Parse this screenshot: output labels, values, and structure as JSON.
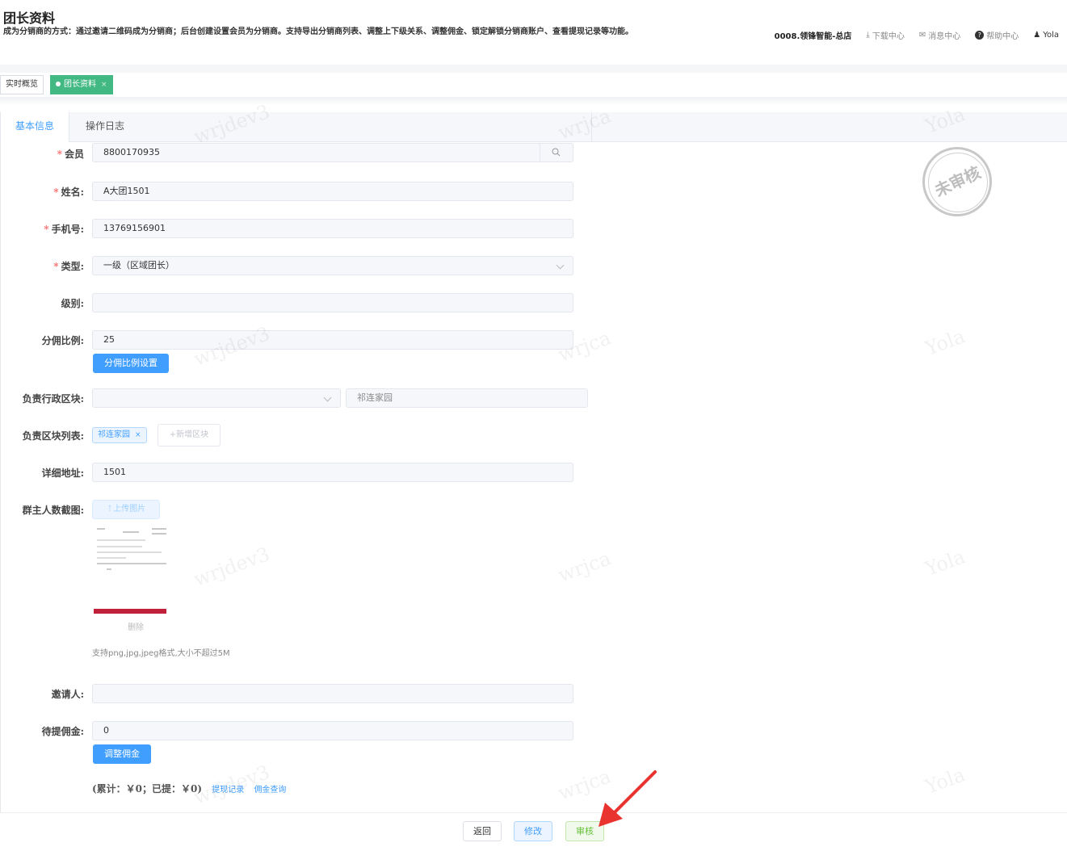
{
  "header": {
    "title": "团长资料",
    "description": "成为分销商的方式：通过邀请二维码成为分销商；后台创建设置会员为分销商。支持导出分销商列表、调整上下级关系、调整佣金、锁定解锁分销商账户、查看提现记录等功能。",
    "store_name": "0008.领锋智能-总店",
    "download_center": "下载中心",
    "message_center": "消息中心",
    "help_center": "帮助中心",
    "user_name": "Yola"
  },
  "page_tabs": [
    {
      "label": "实时概览",
      "active": false
    },
    {
      "label": "团长资料",
      "active": true
    }
  ],
  "form_tabs": [
    {
      "label": "基本信息",
      "active": true
    },
    {
      "label": "操作日志",
      "active": false
    }
  ],
  "form": {
    "member": {
      "label": "会员",
      "value": "8800170935"
    },
    "name": {
      "label": "姓名:",
      "value": "A大团1501"
    },
    "phone": {
      "label": "手机号:",
      "value": "13769156901"
    },
    "type": {
      "label": "类型:",
      "value": "一级（区域团长）"
    },
    "level": {
      "label": "级别:",
      "value": ""
    },
    "commission_ratio": {
      "label": "分佣比例:",
      "value": "25",
      "button": "分佣比例设置"
    },
    "region": {
      "label": "负责行政区块:",
      "value": "",
      "block": "祁连家园"
    },
    "block_list": {
      "label": "负责区块列表:",
      "tag": "祁连家园",
      "add_button": "+新增区块"
    },
    "address": {
      "label": "详细地址:",
      "value": "1501"
    },
    "group_screenshot": {
      "label": "群主人数截图:",
      "upload_button": "上传图片",
      "delete": "删除",
      "hint": "支持png,jpg,jpeg格式,大小不超过5M"
    },
    "inviter": {
      "label": "邀请人:",
      "value": ""
    },
    "pending_commission": {
      "label": "待提佣金:",
      "value": "0",
      "button": "调整佣金"
    },
    "summary": {
      "text": "(累计：￥0；已提：￥0)",
      "withdraw_link": "提现记录",
      "commission_link": "佣金查询"
    }
  },
  "stamp": "未审核",
  "watermarks": [
    "wrjdev3",
    "wrjca",
    "Yola"
  ],
  "footer": {
    "back": "返回",
    "edit": "修改",
    "audit": "审核"
  },
  "colors": {
    "primary": "#409eff",
    "success": "#42b983",
    "danger": "#f56c6c",
    "annotation_arrow": "#e8332e"
  }
}
